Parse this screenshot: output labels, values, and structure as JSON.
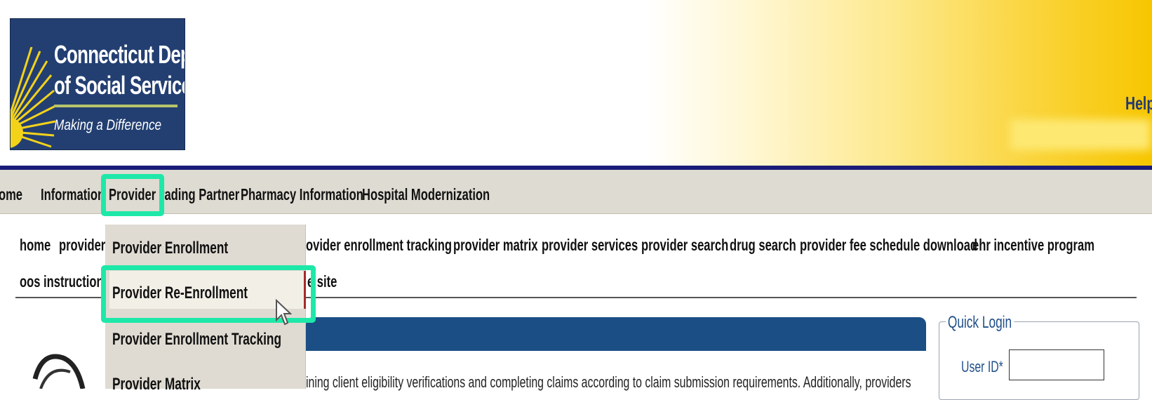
{
  "logo": {
    "line1": "Connecticut Department",
    "line2": "of Social Services",
    "tagline": "Making a Difference"
  },
  "header": {
    "help": "Help"
  },
  "main_menu": {
    "items": [
      "Home",
      "Information",
      "Provider",
      "Trading Partner",
      "Pharmacy Information",
      "Hospital Modernization"
    ],
    "visible": [
      "Home",
      "Information",
      "Provider",
      "rading Partner",
      "Pharmacy Information",
      "Hospital Modernization"
    ],
    "active": "Provider"
  },
  "sub_menu": {
    "row1": [
      "home",
      "provider",
      "ovider enrollment tracking",
      "provider matrix",
      "provider services",
      "provider search",
      "drug search",
      "provider fee schedule download",
      "ehr incentive program"
    ],
    "row2": [
      "oos instructions",
      "e site"
    ]
  },
  "dropdown": {
    "items": [
      "Provider Enrollment",
      "Provider Re-Enrollment",
      "Provider Enrollment Tracking",
      "Provider Matrix"
    ],
    "highlighted": "Provider Re-Enrollment"
  },
  "content": {
    "body_text": "ining client eligibility verifications and completing claims according to claim submission requirements. Additionally, providers"
  },
  "quick_login": {
    "title": "Quick Login",
    "user_id_label": "User ID*",
    "user_id_value": ""
  },
  "colors": {
    "navy": "#1a1c78",
    "band_blue": "#1b4e85",
    "highlight": "#1ee8a8",
    "menu_bg": "#dedbd2"
  }
}
